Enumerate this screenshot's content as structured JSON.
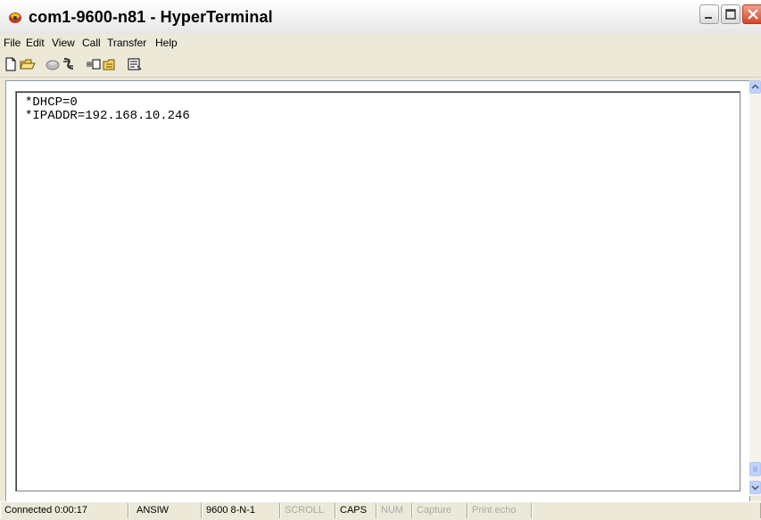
{
  "window": {
    "title": "com1-9600-n81 - HyperTerminal",
    "close_color": "#d2472a",
    "icon": "hyperterminal-phone-icon"
  },
  "menu": [
    "File",
    "Edit",
    "View",
    "Call",
    "Transfer",
    "Help"
  ],
  "toolbar": {
    "icons": [
      "new-icon",
      "open-icon",
      "call-icon",
      "disconnect-icon",
      "send-icon",
      "receive-icon",
      "properties-icon"
    ]
  },
  "terminal": {
    "lines": [
      "*DHCP=0",
      "*IPADDR=192.168.10.246"
    ]
  },
  "status": {
    "connected": "Connected 0:00:17",
    "emulation": "ANSIW",
    "port_settings": "9600 8-N-1",
    "scroll": "SCROLL",
    "caps": "CAPS",
    "num": "NUM",
    "capture": "Capture",
    "print_echo": "Print echo"
  }
}
